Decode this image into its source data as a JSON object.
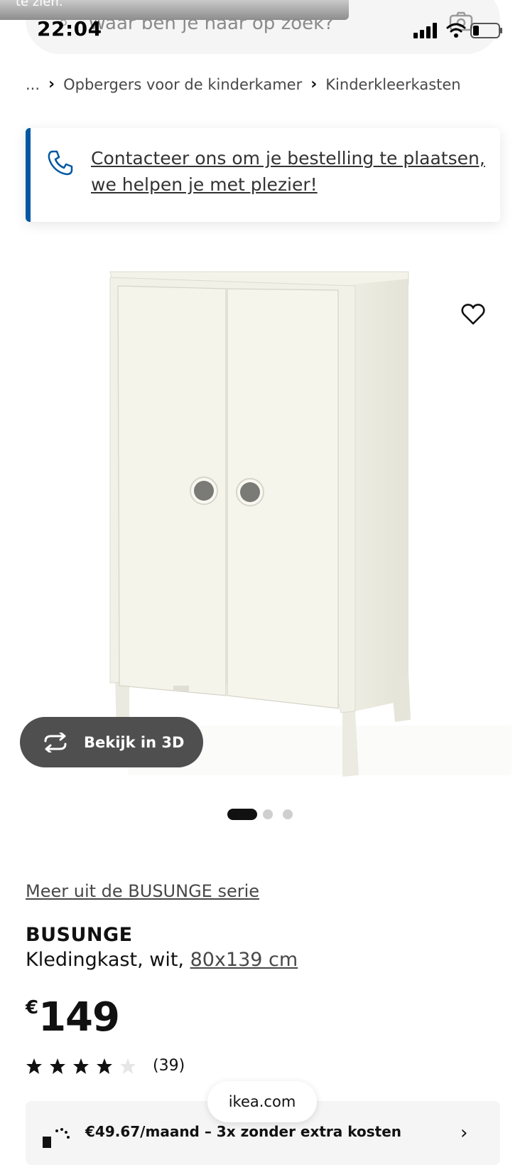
{
  "status_bar": {
    "time": "22:04"
  },
  "toast": {
    "text": "te zien."
  },
  "search": {
    "placeholder": "Waar ben je naar op zoek?"
  },
  "breadcrumb": {
    "ellipsis": "...",
    "items": [
      "Opbergers voor de kinderkamer",
      "Kinderkleerkasten"
    ]
  },
  "contact_banner": {
    "text": "Contacteer ons om je bestelling te plaatsen, we helpen je met plezier!",
    "accent_color": "#0058a3"
  },
  "product_image": {
    "view_3d_label": "Bekijk in 3D",
    "active_slide": 1,
    "slide_count": 3
  },
  "product": {
    "series_link": "Meer uit de BUSUNGE serie",
    "name": "BUSUNGE",
    "description": "Kledingkast, wit, ",
    "size": "80x139 cm",
    "price_currency": "€",
    "price_value": "149",
    "rating_stars": 4,
    "rating_max": 5,
    "review_count": "(39)"
  },
  "domain": "ikea.com",
  "installment": {
    "text": "€49.67/maand – 3x zonder extra kosten"
  }
}
